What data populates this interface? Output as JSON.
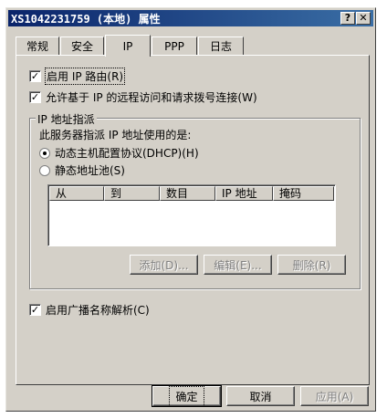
{
  "window": {
    "title": "XS1042231759 (本地) 属性"
  },
  "titlebar": {
    "help_label": "?",
    "close_label": "✕"
  },
  "tabs": [
    {
      "label": "常规"
    },
    {
      "label": "安全"
    },
    {
      "label": "IP"
    },
    {
      "label": "PPP"
    },
    {
      "label": "日志"
    }
  ],
  "options": {
    "enable_ip_routing": {
      "label": "启用 IP 路由(R)",
      "checked": true
    },
    "allow_remote_access": {
      "label": "允许基于 IP 的远程访问和请求拨号连接(W)",
      "checked": true
    },
    "enable_broadcast": {
      "label": "启用广播名称解析(C)",
      "checked": true
    }
  },
  "ip_assignment": {
    "group_title": "IP 地址指派",
    "description": "此服务器指派 IP 地址使用的是:",
    "radio_dhcp": {
      "label": "动态主机配置协议(DHCP)(H)",
      "selected": true
    },
    "radio_static": {
      "label": "静态地址池(S)",
      "selected": false
    },
    "columns": [
      "从",
      "到",
      "数目",
      "IP 地址",
      "掩码"
    ],
    "buttons": {
      "add": "添加(D)...",
      "edit": "编辑(E)...",
      "remove": "删除(R)"
    }
  },
  "footer": {
    "ok": "确定",
    "cancel": "取消",
    "apply": "应用(A)"
  },
  "checkmark": "✓",
  "colors": {
    "title_start": "#0a246a",
    "title_end": "#3a6ea5",
    "face": "#d4d0c8"
  }
}
